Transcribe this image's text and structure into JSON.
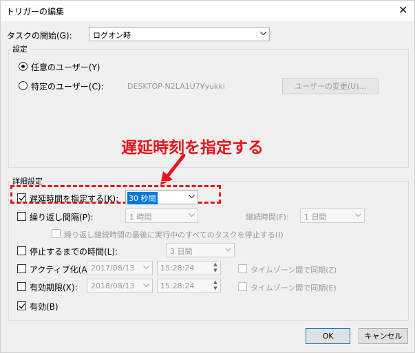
{
  "window": {
    "title": "トリガーの編集",
    "close_glyph": "✕"
  },
  "task_start": {
    "label": "タスクの開始(G):",
    "value": "ログオン時"
  },
  "settings": {
    "group_label": "設定",
    "any_user_label": "任意のユーザー(Y)",
    "specific_user_label": "特定のユーザー(C):",
    "user_name": "DESKTOP-N2LA1U7¥yukki",
    "change_user_button": "ユーザーの変更(U)..."
  },
  "annotation": {
    "text": "遅延時刻を指定する",
    "color": "#e3151b"
  },
  "advanced": {
    "group_label": "詳細設定",
    "delay": {
      "label": "遅延時間を指定する(K):",
      "value": "30 秒間",
      "checked": true
    },
    "repeat": {
      "label": "繰り返し間隔(P):",
      "value": "1 時間",
      "duration_label": "継続時間(F):",
      "duration_value": "1 日間",
      "checked": false
    },
    "stop_repeat_label": "繰り返し継続時間の最後に実行中のすべてのタスクを停止する(I)",
    "stop_after": {
      "label": "停止するまでの時間(L):",
      "value": "3 日間",
      "checked": false
    },
    "activate": {
      "label": "アクティブ化(A):",
      "date": "2017/08/13",
      "time": "15:28:24",
      "sync_label": "タイムゾーン間で同期(Z)",
      "checked": false
    },
    "expire": {
      "label": "有効期限(X):",
      "date": "2018/08/13",
      "time": "15:28:24",
      "sync_label": "タイムゾーン間で同期(E)",
      "checked": false
    },
    "enabled": {
      "label": "有効(B)",
      "checked": true
    }
  },
  "buttons": {
    "ok": "OK",
    "cancel": "キャンセル"
  },
  "colors": {
    "accent_blue": "#0078d7",
    "selection": "#0078d7"
  }
}
